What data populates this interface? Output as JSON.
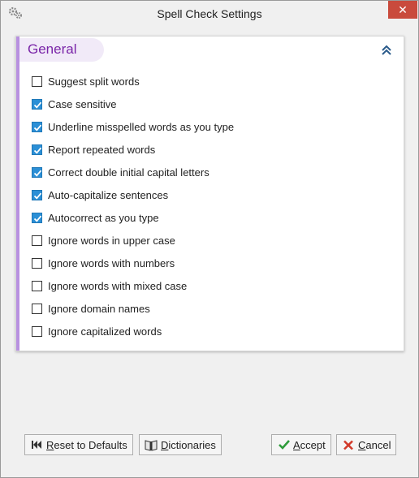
{
  "window": {
    "title": "Spell Check Settings",
    "close_label": "✕"
  },
  "section": {
    "title": "General",
    "options": [
      {
        "label": "Suggest split words",
        "checked": false
      },
      {
        "label": "Case sensitive",
        "checked": true
      },
      {
        "label": "Underline misspelled words as you type",
        "checked": true
      },
      {
        "label": "Report repeated words",
        "checked": true
      },
      {
        "label": "Correct double initial capital letters",
        "checked": true
      },
      {
        "label": "Auto-capitalize sentences",
        "checked": true
      },
      {
        "label": "Autocorrect as you type",
        "checked": true
      },
      {
        "label": "Ignore words in upper case",
        "checked": false
      },
      {
        "label": "Ignore words with numbers",
        "checked": false
      },
      {
        "label": "Ignore words with mixed case",
        "checked": false
      },
      {
        "label": "Ignore domain names",
        "checked": false
      },
      {
        "label": "Ignore capitalized words",
        "checked": false
      }
    ]
  },
  "buttons": {
    "reset": "Reset to Defaults",
    "dictionaries": "Dictionaries",
    "accept": "Accept",
    "cancel": "Cancel"
  },
  "colors": {
    "accent": "#7a25a8",
    "accent_bar": "#b891e0",
    "checkbox_checked": "#2b8fd6",
    "close_button": "#c94a3c",
    "accept_icon": "#2e9b3a",
    "cancel_icon": "#d23b2b"
  },
  "icons": {
    "app": "gears-icon",
    "collapse": "double-chevron-up-icon",
    "reset": "skip-to-start-icon",
    "dictionaries": "book-icon",
    "accept": "checkmark-icon",
    "cancel": "x-icon"
  }
}
